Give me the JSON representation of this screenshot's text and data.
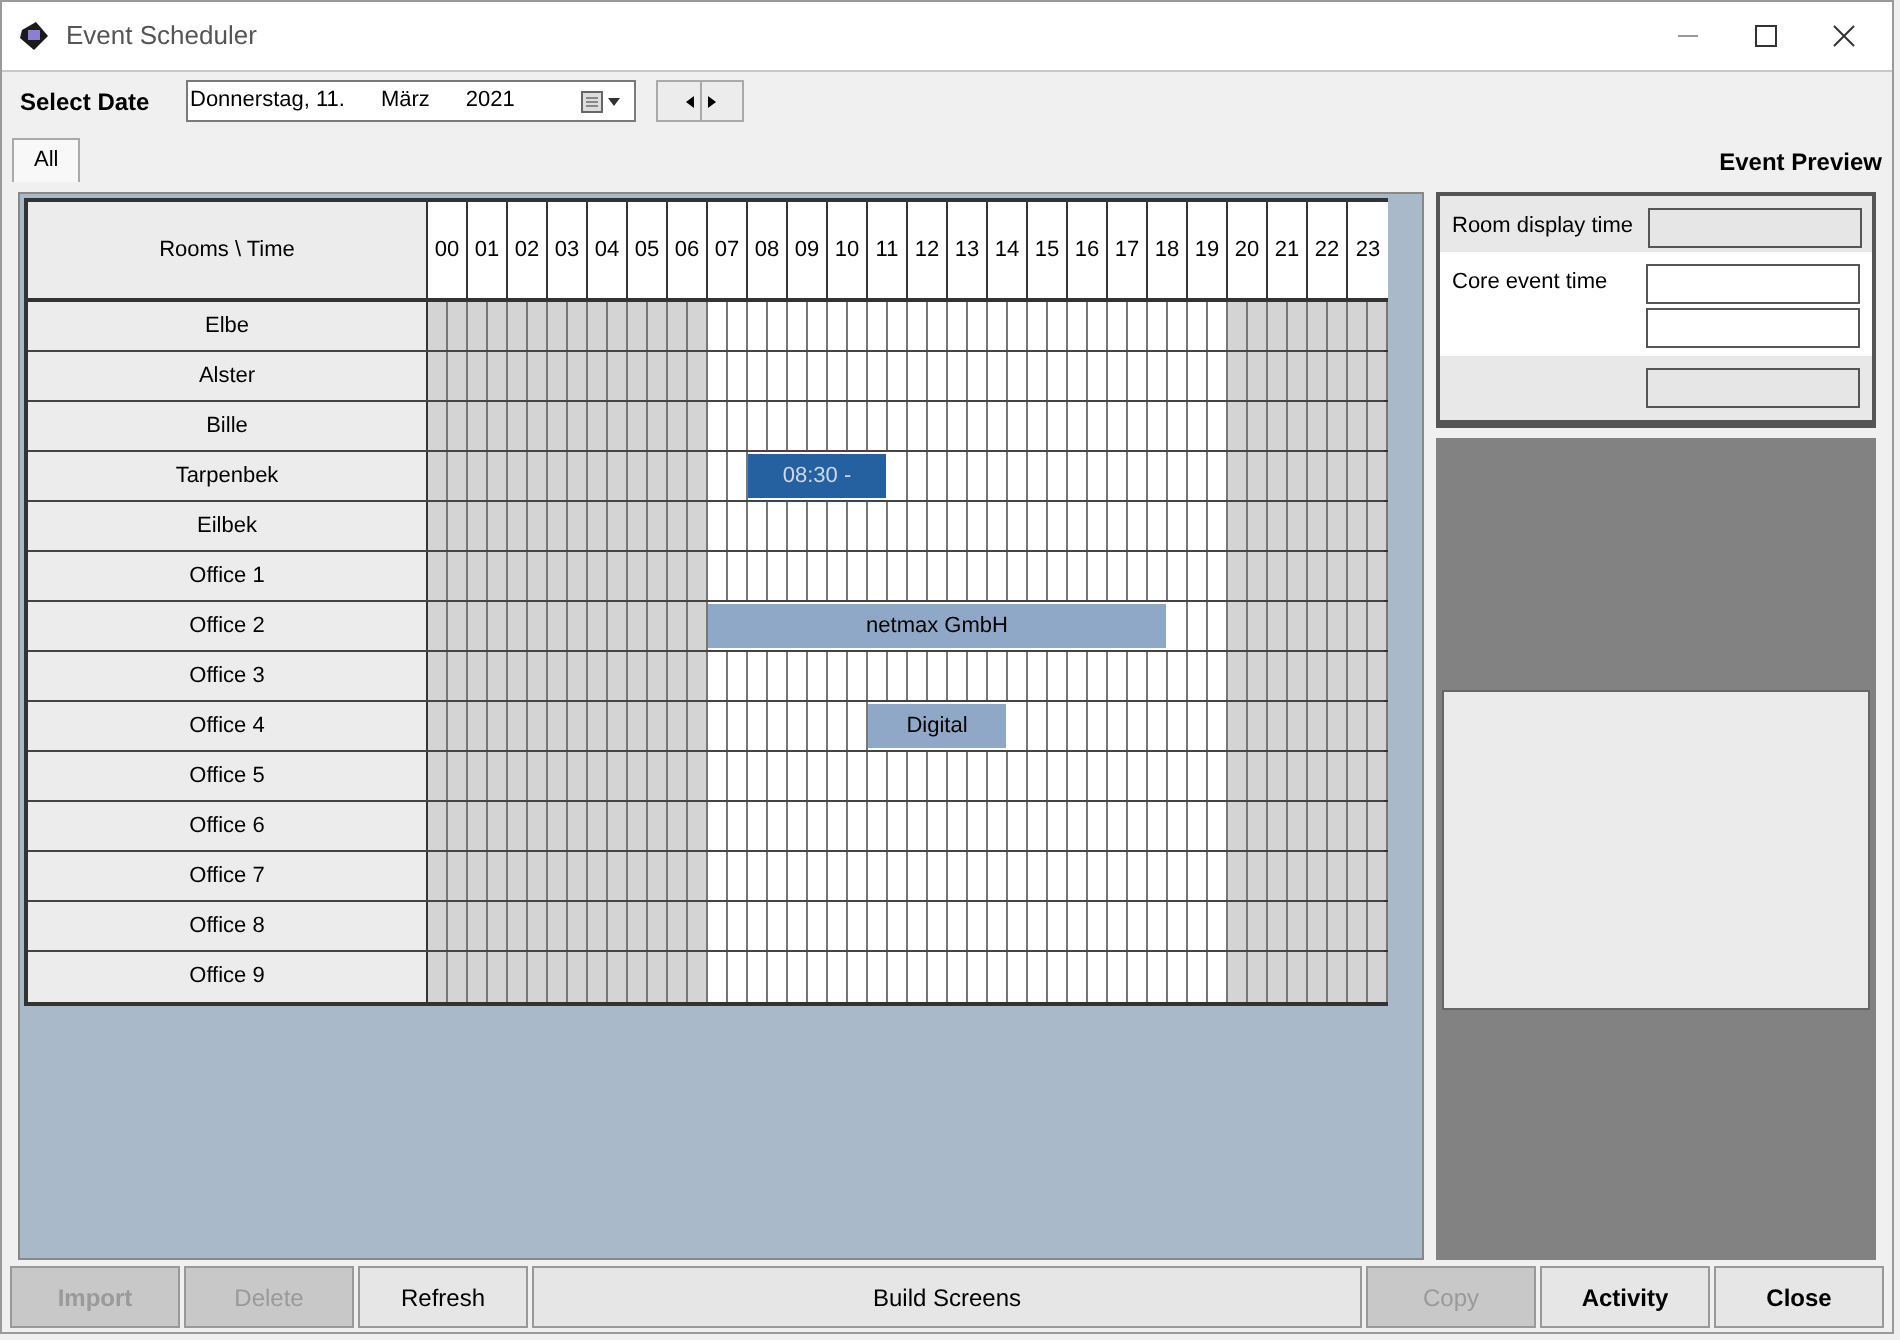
{
  "window": {
    "title": "Event Scheduler"
  },
  "toolbar": {
    "label": "Select Date",
    "date": {
      "weekday": "Donnerstag, 11.",
      "month": "März",
      "year": "2021"
    }
  },
  "tabs": [
    {
      "label": "All",
      "selected": true
    }
  ],
  "preview": {
    "title": "Event Preview",
    "fields": [
      {
        "label": "Room display time",
        "kind": "readonly"
      },
      {
        "label": "Core event time",
        "kind": "double"
      },
      {
        "kind": "readonly"
      }
    ]
  },
  "schedule": {
    "corner": "Rooms \\ Time",
    "hours": [
      {
        "label": "00",
        "open": false
      },
      {
        "label": "01",
        "open": false
      },
      {
        "label": "02",
        "open": false
      },
      {
        "label": "03",
        "open": false
      },
      {
        "label": "04",
        "open": false
      },
      {
        "label": "05",
        "open": false
      },
      {
        "label": "06",
        "open": false
      },
      {
        "label": "07",
        "open": true
      },
      {
        "label": "08",
        "open": true
      },
      {
        "label": "09",
        "open": true
      },
      {
        "label": "10",
        "open": true
      },
      {
        "label": "11",
        "open": true
      },
      {
        "label": "12",
        "open": true
      },
      {
        "label": "13",
        "open": true
      },
      {
        "label": "14",
        "open": true
      },
      {
        "label": "15",
        "open": true
      },
      {
        "label": "16",
        "open": true
      },
      {
        "label": "17",
        "open": true
      },
      {
        "label": "18",
        "open": true
      },
      {
        "label": "19",
        "open": true
      },
      {
        "label": "20",
        "open": false
      },
      {
        "label": "21",
        "open": false
      },
      {
        "label": "22",
        "open": false
      },
      {
        "label": "23",
        "open": false
      }
    ],
    "rooms": [
      {
        "name": "Elbe"
      },
      {
        "name": "Alster"
      },
      {
        "name": "Bille"
      },
      {
        "name": "Tarpenbek",
        "timeline": [
          {
            "kind": "free"
          },
          {
            "kind": "free"
          },
          {
            "kind": "free"
          },
          {
            "kind": "free"
          },
          {
            "kind": "free"
          },
          {
            "kind": "free"
          },
          {
            "kind": "free"
          },
          {
            "kind": "free"
          },
          {
            "kind": "free"
          },
          {
            "kind": "free"
          },
          {
            "kind": "free"
          },
          {
            "kind": "free"
          },
          {
            "kind": "free"
          },
          {
            "kind": "free"
          },
          {
            "kind": "free"
          },
          {
            "kind": "free"
          },
          {
            "kind": "event",
            "label": "08:30 -",
            "selected": true
          },
          {
            "kind": "booked"
          },
          {
            "kind": "booked"
          },
          {
            "kind": "booked"
          },
          {
            "kind": "booked"
          },
          {
            "kind": "booked"
          },
          {
            "kind": "booked"
          },
          {
            "kind": "free"
          },
          {
            "kind": "free"
          },
          {
            "kind": "free"
          },
          {
            "kind": "free"
          },
          {
            "kind": "free"
          },
          {
            "kind": "free"
          },
          {
            "kind": "free"
          },
          {
            "kind": "free"
          },
          {
            "kind": "free"
          },
          {
            "kind": "free"
          },
          {
            "kind": "free"
          },
          {
            "kind": "free"
          },
          {
            "kind": "free"
          },
          {
            "kind": "free"
          },
          {
            "kind": "free"
          },
          {
            "kind": "free"
          },
          {
            "kind": "free"
          },
          {
            "kind": "free"
          },
          {
            "kind": "free"
          },
          {
            "kind": "free"
          },
          {
            "kind": "free"
          },
          {
            "kind": "free"
          },
          {
            "kind": "free"
          },
          {
            "kind": "free"
          },
          {
            "kind": "free"
          }
        ]
      },
      {
        "name": "Eilbek"
      },
      {
        "name": "Office 1"
      },
      {
        "name": "Office 2",
        "timeline": [
          {
            "kind": "free"
          },
          {
            "kind": "free"
          },
          {
            "kind": "free"
          },
          {
            "kind": "free"
          },
          {
            "kind": "free"
          },
          {
            "kind": "free"
          },
          {
            "kind": "free"
          },
          {
            "kind": "free"
          },
          {
            "kind": "free"
          },
          {
            "kind": "free"
          },
          {
            "kind": "free"
          },
          {
            "kind": "free"
          },
          {
            "kind": "free"
          },
          {
            "kind": "free"
          },
          {
            "kind": "event",
            "label": "netmax GmbH",
            "selected": false
          },
          {
            "kind": "booked"
          },
          {
            "kind": "booked"
          },
          {
            "kind": "booked"
          },
          {
            "kind": "booked"
          },
          {
            "kind": "booked"
          },
          {
            "kind": "booked"
          },
          {
            "kind": "booked"
          },
          {
            "kind": "booked"
          },
          {
            "kind": "booked"
          },
          {
            "kind": "booked"
          },
          {
            "kind": "booked"
          },
          {
            "kind": "booked"
          },
          {
            "kind": "booked"
          },
          {
            "kind": "booked"
          },
          {
            "kind": "booked"
          },
          {
            "kind": "booked"
          },
          {
            "kind": "booked"
          },
          {
            "kind": "booked"
          },
          {
            "kind": "booked"
          },
          {
            "kind": "booked"
          },
          {
            "kind": "booked"
          },
          {
            "kind": "booked"
          },
          {
            "kind": "free"
          },
          {
            "kind": "free"
          },
          {
            "kind": "free"
          },
          {
            "kind": "free"
          },
          {
            "kind": "free"
          },
          {
            "kind": "free"
          },
          {
            "kind": "free"
          },
          {
            "kind": "free"
          },
          {
            "kind": "free"
          },
          {
            "kind": "free"
          },
          {
            "kind": "free"
          }
        ]
      },
      {
        "name": "Office 3"
      },
      {
        "name": "Office 4",
        "timeline": [
          {
            "kind": "free"
          },
          {
            "kind": "free"
          },
          {
            "kind": "free"
          },
          {
            "kind": "free"
          },
          {
            "kind": "free"
          },
          {
            "kind": "free"
          },
          {
            "kind": "free"
          },
          {
            "kind": "free"
          },
          {
            "kind": "free"
          },
          {
            "kind": "free"
          },
          {
            "kind": "free"
          },
          {
            "kind": "free"
          },
          {
            "kind": "free"
          },
          {
            "kind": "free"
          },
          {
            "kind": "free"
          },
          {
            "kind": "free"
          },
          {
            "kind": "free"
          },
          {
            "kind": "free"
          },
          {
            "kind": "free"
          },
          {
            "kind": "free"
          },
          {
            "kind": "free"
          },
          {
            "kind": "free"
          },
          {
            "kind": "event",
            "label": "Digital",
            "selected": false
          },
          {
            "kind": "booked"
          },
          {
            "kind": "booked"
          },
          {
            "kind": "booked"
          },
          {
            "kind": "booked"
          },
          {
            "kind": "booked"
          },
          {
            "kind": "booked"
          },
          {
            "kind": "free"
          },
          {
            "kind": "free"
          },
          {
            "kind": "free"
          },
          {
            "kind": "free"
          },
          {
            "kind": "free"
          },
          {
            "kind": "free"
          },
          {
            "kind": "free"
          },
          {
            "kind": "free"
          },
          {
            "kind": "free"
          },
          {
            "kind": "free"
          },
          {
            "kind": "free"
          },
          {
            "kind": "free"
          },
          {
            "kind": "free"
          },
          {
            "kind": "free"
          },
          {
            "kind": "free"
          },
          {
            "kind": "free"
          },
          {
            "kind": "free"
          },
          {
            "kind": "free"
          },
          {
            "kind": "free"
          }
        ]
      },
      {
        "name": "Office 5"
      },
      {
        "name": "Office 6"
      },
      {
        "name": "Office 7"
      },
      {
        "name": "Office 8"
      },
      {
        "name": "Office 9"
      }
    ]
  },
  "buttons": [
    {
      "label": "Import",
      "disabled": true,
      "bold": true
    },
    {
      "label": "Delete",
      "disabled": true,
      "bold": false
    },
    {
      "label": "Refresh",
      "disabled": false,
      "bold": false
    },
    {
      "label": "Build Screens",
      "disabled": false,
      "bold": false,
      "wide": true
    },
    {
      "label": "Copy",
      "disabled": true,
      "bold": false
    },
    {
      "label": "Activity",
      "disabled": false,
      "bold": true
    },
    {
      "label": "Close",
      "disabled": false,
      "bold": true
    }
  ]
}
